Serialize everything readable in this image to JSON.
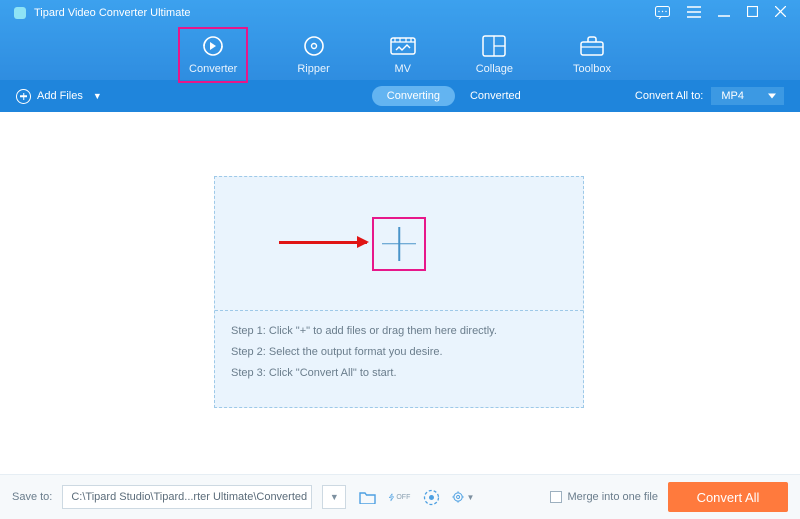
{
  "titlebar": {
    "title": "Tipard Video Converter Ultimate"
  },
  "tabs": [
    {
      "key": "converter",
      "label": "Converter",
      "active": true
    },
    {
      "key": "ripper",
      "label": "Ripper"
    },
    {
      "key": "mv",
      "label": "MV"
    },
    {
      "key": "collage",
      "label": "Collage"
    },
    {
      "key": "toolbox",
      "label": "Toolbox"
    }
  ],
  "subbar": {
    "add_files": "Add Files",
    "seg_converting": "Converting",
    "seg_converted": "Converted",
    "convert_all_to": "Convert All to:",
    "format": "MP4"
  },
  "drop": {
    "step1": "Step 1: Click \"+\" to add files or drag them here directly.",
    "step2": "Step 2: Select the output format you desire.",
    "step3": "Step 3: Click \"Convert All\" to start."
  },
  "bottom": {
    "save_to_label": "Save to:",
    "path": "C:\\Tipard Studio\\Tipard...rter Ultimate\\Converted",
    "merge_label": "Merge into one file",
    "convert_all": "Convert All"
  }
}
